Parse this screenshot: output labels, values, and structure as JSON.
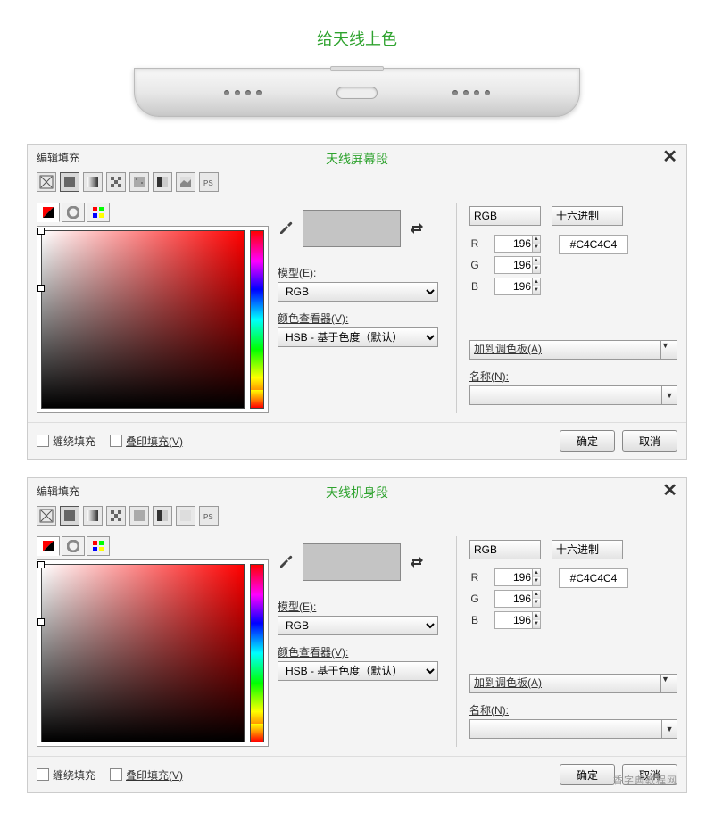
{
  "page_title": "给天线上色",
  "dialogs": [
    {
      "title": "编辑填充",
      "subtitle": "天线屏幕段",
      "model_label": "模型(E):",
      "model_value": "RGB",
      "viewer_label": "颜色查看器(V):",
      "viewer_value": "HSB - 基于色度（默认）",
      "mode_select": "RGB",
      "format_select": "十六进制",
      "r_label": "R",
      "r_value": "196",
      "g_label": "G",
      "g_value": "196",
      "b_label": "B",
      "b_value": "196",
      "hex_value": "#C4C4C4",
      "palette_value": "加到调色板(A)",
      "name_label": "名称(N):",
      "name_value": "",
      "wrap_label": "缠绕填充",
      "overlap_label": "叠印填充(V)",
      "ok": "确定",
      "cancel": "取消"
    },
    {
      "title": "编辑填充",
      "subtitle": "天线机身段",
      "model_label": "模型(E):",
      "model_value": "RGB",
      "viewer_label": "颜色查看器(V):",
      "viewer_value": "HSB - 基于色度（默认）",
      "mode_select": "RGB",
      "format_select": "十六进制",
      "r_label": "R",
      "r_value": "196",
      "g_label": "G",
      "g_value": "196",
      "b_label": "B",
      "b_value": "196",
      "hex_value": "#C4C4C4",
      "palette_value": "加到调色板(A)",
      "name_label": "名称(N):",
      "name_value": "",
      "wrap_label": "缠绕填充",
      "overlap_label": "叠印填充(V)",
      "ok": "确定",
      "cancel": "取消"
    }
  ],
  "watermark": "香字典教程网"
}
